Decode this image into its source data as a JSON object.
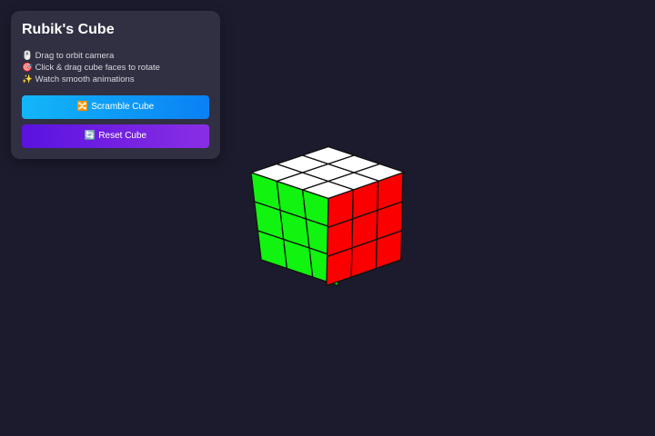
{
  "panel": {
    "title": "Rubik's Cube",
    "instructions": [
      {
        "icon": "🖱️",
        "icon_name": "mouse-icon",
        "text": "Drag to orbit camera"
      },
      {
        "icon": "🎯",
        "icon_name": "target-icon",
        "text": "Click & drag cube faces to rotate"
      },
      {
        "icon": "✨",
        "icon_name": "sparkles-icon",
        "text": "Watch smooth animations"
      }
    ],
    "scramble_button": {
      "icon": "🔀",
      "icon_name": "shuffle-icon",
      "label": "Scramble Cube"
    },
    "reset_button": {
      "icon": "🔄",
      "icon_name": "reset-icon",
      "label": "Reset Cube"
    }
  },
  "cube": {
    "state": "solved",
    "faces": {
      "top": {
        "color": "#ffffff",
        "name": "white"
      },
      "left": {
        "color": "#10f410",
        "name": "green"
      },
      "right": {
        "color": "#fb0000",
        "name": "red"
      }
    }
  },
  "colors": {
    "background": "#1b1b2d",
    "panel": "#303042",
    "scramble_gradient": [
      "#12b7f7",
      "#0a80f5"
    ],
    "reset_gradient": [
      "#5a12e0",
      "#8a2ee4"
    ]
  }
}
